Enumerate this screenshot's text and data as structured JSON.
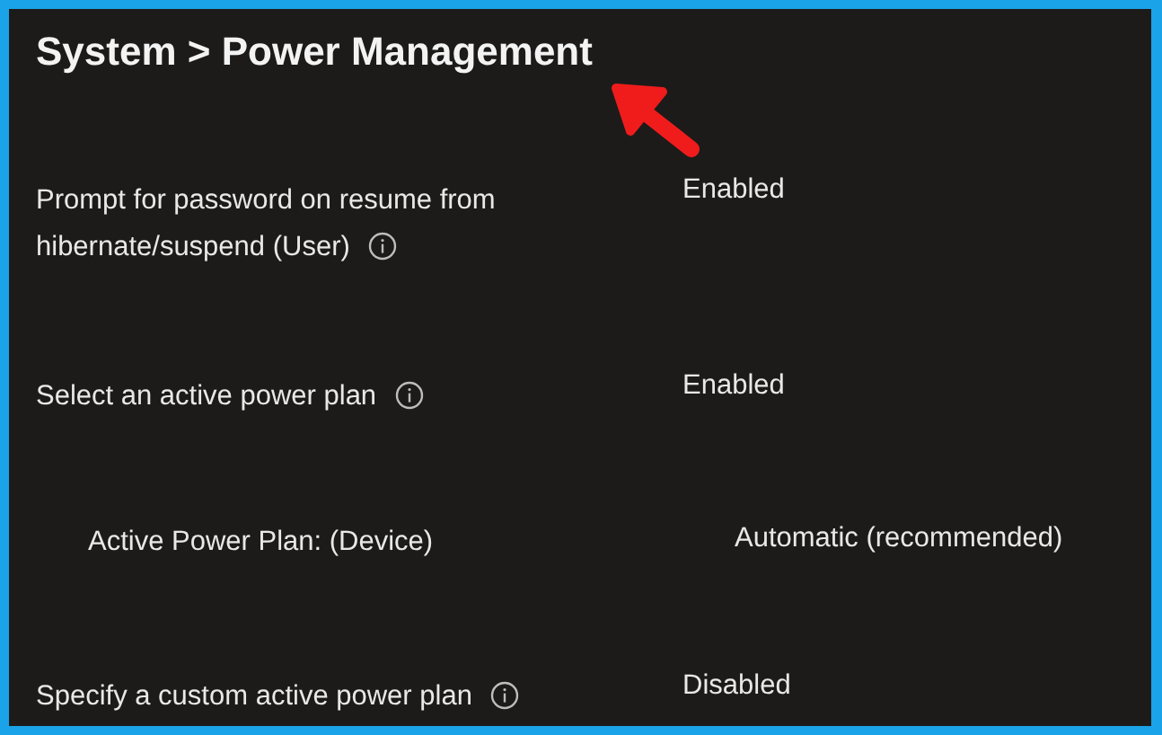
{
  "title": "System > Power Management",
  "settings": [
    {
      "label": "Prompt for password on resume from hibernate/suspend (User)",
      "info_icon": true,
      "value": "Enabled"
    },
    {
      "label": "Select an active power plan",
      "info_icon": true,
      "value": "Enabled",
      "children": [
        {
          "label": "Active Power Plan: (Device)",
          "info_icon": false,
          "value": "Automatic (recommended)"
        }
      ]
    },
    {
      "label": "Specify a custom active power plan",
      "info_icon": true,
      "value": "Disabled"
    }
  ]
}
